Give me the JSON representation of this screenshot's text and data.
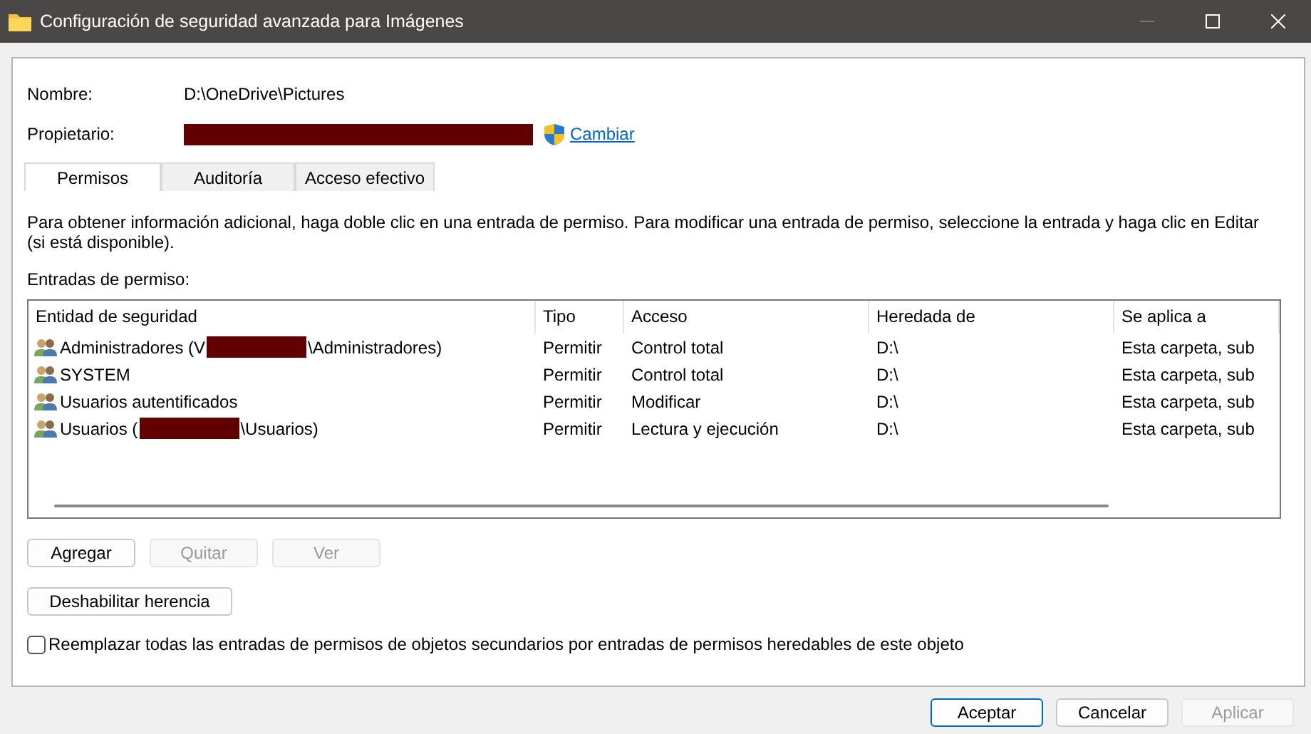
{
  "window": {
    "title": "Configuración de seguridad avanzada para Imágenes"
  },
  "fields": [
    {
      "label": "Nombre:",
      "value": "D:\\OneDrive\\Pictures"
    },
    {
      "label": "Propietario:",
      "redacted": true,
      "link": "Cambiar"
    }
  ],
  "tabs": [
    {
      "label": "Permisos",
      "selected": true
    },
    {
      "label": "Auditoría",
      "selected": false
    },
    {
      "label": "Acceso efectivo",
      "selected": false
    }
  ],
  "info_text": "Para obtener información adicional, haga doble clic en una entrada de permiso. Para modificar una entrada de permiso, seleccione la entrada y haga clic en Editar (si está disponible).",
  "table": {
    "label": "Entradas de permiso:",
    "columns": [
      "Entidad de seguridad",
      "Tipo",
      "Acceso",
      "Heredada de",
      "Se aplica a"
    ],
    "rows": [
      {
        "cells": [
          {
            "prefix": "Administradores (V",
            "redacted": true,
            "suffix": "\\Administradores)"
          },
          {
            "text": "Permitir"
          },
          {
            "text": "Control total"
          },
          {
            "text": "D:\\"
          },
          {
            "text": "Esta carpeta, sub"
          }
        ]
      },
      {
        "cells": [
          {
            "prefix": "SYSTEM"
          },
          {
            "text": "Permitir"
          },
          {
            "text": "Control total"
          },
          {
            "text": "D:\\"
          },
          {
            "text": "Esta carpeta, sub"
          }
        ]
      },
      {
        "cells": [
          {
            "prefix": "Usuarios autentificados"
          },
          {
            "text": "Permitir"
          },
          {
            "text": "Modificar"
          },
          {
            "text": "D:\\"
          },
          {
            "text": "Esta carpeta, sub"
          }
        ]
      },
      {
        "cells": [
          {
            "prefix": "Usuarios (",
            "redacted": true,
            "suffix": "\\Usuarios)"
          },
          {
            "text": "Permitir"
          },
          {
            "text": "Lectura y ejecución"
          },
          {
            "text": "D:\\"
          },
          {
            "text": "Esta carpeta, sub"
          }
        ]
      }
    ]
  },
  "entry_buttons": [
    {
      "label": "Agregar",
      "disabled": false
    },
    {
      "label": "Quitar",
      "disabled": true
    },
    {
      "label": "Ver",
      "disabled": true
    }
  ],
  "inheritance_button": {
    "label": "Deshabilitar herencia",
    "disabled": false
  },
  "replace_checkbox": {
    "label": "Reemplazar todas las entradas de permisos de objetos secundarios por entradas de permisos heredables de este objeto",
    "checked": false
  },
  "footer_buttons": [
    {
      "label": "Aceptar",
      "disabled": false,
      "default": true
    },
    {
      "label": "Cancelar",
      "disabled": false,
      "default": false
    },
    {
      "label": "Aplicar",
      "disabled": true,
      "default": false
    }
  ]
}
